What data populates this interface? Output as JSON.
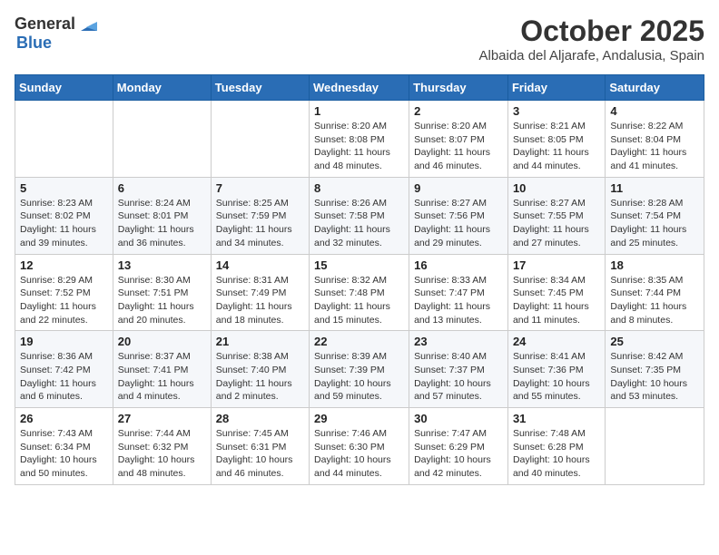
{
  "logo": {
    "general": "General",
    "blue": "Blue"
  },
  "title": "October 2025",
  "location": "Albaida del Aljarafe, Andalusia, Spain",
  "days_of_week": [
    "Sunday",
    "Monday",
    "Tuesday",
    "Wednesday",
    "Thursday",
    "Friday",
    "Saturday"
  ],
  "weeks": [
    [
      {
        "day": "",
        "sunrise": "",
        "sunset": "",
        "daylight": ""
      },
      {
        "day": "",
        "sunrise": "",
        "sunset": "",
        "daylight": ""
      },
      {
        "day": "",
        "sunrise": "",
        "sunset": "",
        "daylight": ""
      },
      {
        "day": "1",
        "sunrise": "Sunrise: 8:20 AM",
        "sunset": "Sunset: 8:08 PM",
        "daylight": "Daylight: 11 hours and 48 minutes."
      },
      {
        "day": "2",
        "sunrise": "Sunrise: 8:20 AM",
        "sunset": "Sunset: 8:07 PM",
        "daylight": "Daylight: 11 hours and 46 minutes."
      },
      {
        "day": "3",
        "sunrise": "Sunrise: 8:21 AM",
        "sunset": "Sunset: 8:05 PM",
        "daylight": "Daylight: 11 hours and 44 minutes."
      },
      {
        "day": "4",
        "sunrise": "Sunrise: 8:22 AM",
        "sunset": "Sunset: 8:04 PM",
        "daylight": "Daylight: 11 hours and 41 minutes."
      }
    ],
    [
      {
        "day": "5",
        "sunrise": "Sunrise: 8:23 AM",
        "sunset": "Sunset: 8:02 PM",
        "daylight": "Daylight: 11 hours and 39 minutes."
      },
      {
        "day": "6",
        "sunrise": "Sunrise: 8:24 AM",
        "sunset": "Sunset: 8:01 PM",
        "daylight": "Daylight: 11 hours and 36 minutes."
      },
      {
        "day": "7",
        "sunrise": "Sunrise: 8:25 AM",
        "sunset": "Sunset: 7:59 PM",
        "daylight": "Daylight: 11 hours and 34 minutes."
      },
      {
        "day": "8",
        "sunrise": "Sunrise: 8:26 AM",
        "sunset": "Sunset: 7:58 PM",
        "daylight": "Daylight: 11 hours and 32 minutes."
      },
      {
        "day": "9",
        "sunrise": "Sunrise: 8:27 AM",
        "sunset": "Sunset: 7:56 PM",
        "daylight": "Daylight: 11 hours and 29 minutes."
      },
      {
        "day": "10",
        "sunrise": "Sunrise: 8:27 AM",
        "sunset": "Sunset: 7:55 PM",
        "daylight": "Daylight: 11 hours and 27 minutes."
      },
      {
        "day": "11",
        "sunrise": "Sunrise: 8:28 AM",
        "sunset": "Sunset: 7:54 PM",
        "daylight": "Daylight: 11 hours and 25 minutes."
      }
    ],
    [
      {
        "day": "12",
        "sunrise": "Sunrise: 8:29 AM",
        "sunset": "Sunset: 7:52 PM",
        "daylight": "Daylight: 11 hours and 22 minutes."
      },
      {
        "day": "13",
        "sunrise": "Sunrise: 8:30 AM",
        "sunset": "Sunset: 7:51 PM",
        "daylight": "Daylight: 11 hours and 20 minutes."
      },
      {
        "day": "14",
        "sunrise": "Sunrise: 8:31 AM",
        "sunset": "Sunset: 7:49 PM",
        "daylight": "Daylight: 11 hours and 18 minutes."
      },
      {
        "day": "15",
        "sunrise": "Sunrise: 8:32 AM",
        "sunset": "Sunset: 7:48 PM",
        "daylight": "Daylight: 11 hours and 15 minutes."
      },
      {
        "day": "16",
        "sunrise": "Sunrise: 8:33 AM",
        "sunset": "Sunset: 7:47 PM",
        "daylight": "Daylight: 11 hours and 13 minutes."
      },
      {
        "day": "17",
        "sunrise": "Sunrise: 8:34 AM",
        "sunset": "Sunset: 7:45 PM",
        "daylight": "Daylight: 11 hours and 11 minutes."
      },
      {
        "day": "18",
        "sunrise": "Sunrise: 8:35 AM",
        "sunset": "Sunset: 7:44 PM",
        "daylight": "Daylight: 11 hours and 8 minutes."
      }
    ],
    [
      {
        "day": "19",
        "sunrise": "Sunrise: 8:36 AM",
        "sunset": "Sunset: 7:42 PM",
        "daylight": "Daylight: 11 hours and 6 minutes."
      },
      {
        "day": "20",
        "sunrise": "Sunrise: 8:37 AM",
        "sunset": "Sunset: 7:41 PM",
        "daylight": "Daylight: 11 hours and 4 minutes."
      },
      {
        "day": "21",
        "sunrise": "Sunrise: 8:38 AM",
        "sunset": "Sunset: 7:40 PM",
        "daylight": "Daylight: 11 hours and 2 minutes."
      },
      {
        "day": "22",
        "sunrise": "Sunrise: 8:39 AM",
        "sunset": "Sunset: 7:39 PM",
        "daylight": "Daylight: 10 hours and 59 minutes."
      },
      {
        "day": "23",
        "sunrise": "Sunrise: 8:40 AM",
        "sunset": "Sunset: 7:37 PM",
        "daylight": "Daylight: 10 hours and 57 minutes."
      },
      {
        "day": "24",
        "sunrise": "Sunrise: 8:41 AM",
        "sunset": "Sunset: 7:36 PM",
        "daylight": "Daylight: 10 hours and 55 minutes."
      },
      {
        "day": "25",
        "sunrise": "Sunrise: 8:42 AM",
        "sunset": "Sunset: 7:35 PM",
        "daylight": "Daylight: 10 hours and 53 minutes."
      }
    ],
    [
      {
        "day": "26",
        "sunrise": "Sunrise: 7:43 AM",
        "sunset": "Sunset: 6:34 PM",
        "daylight": "Daylight: 10 hours and 50 minutes."
      },
      {
        "day": "27",
        "sunrise": "Sunrise: 7:44 AM",
        "sunset": "Sunset: 6:32 PM",
        "daylight": "Daylight: 10 hours and 48 minutes."
      },
      {
        "day": "28",
        "sunrise": "Sunrise: 7:45 AM",
        "sunset": "Sunset: 6:31 PM",
        "daylight": "Daylight: 10 hours and 46 minutes."
      },
      {
        "day": "29",
        "sunrise": "Sunrise: 7:46 AM",
        "sunset": "Sunset: 6:30 PM",
        "daylight": "Daylight: 10 hours and 44 minutes."
      },
      {
        "day": "30",
        "sunrise": "Sunrise: 7:47 AM",
        "sunset": "Sunset: 6:29 PM",
        "daylight": "Daylight: 10 hours and 42 minutes."
      },
      {
        "day": "31",
        "sunrise": "Sunrise: 7:48 AM",
        "sunset": "Sunset: 6:28 PM",
        "daylight": "Daylight: 10 hours and 40 minutes."
      },
      {
        "day": "",
        "sunrise": "",
        "sunset": "",
        "daylight": ""
      }
    ]
  ]
}
